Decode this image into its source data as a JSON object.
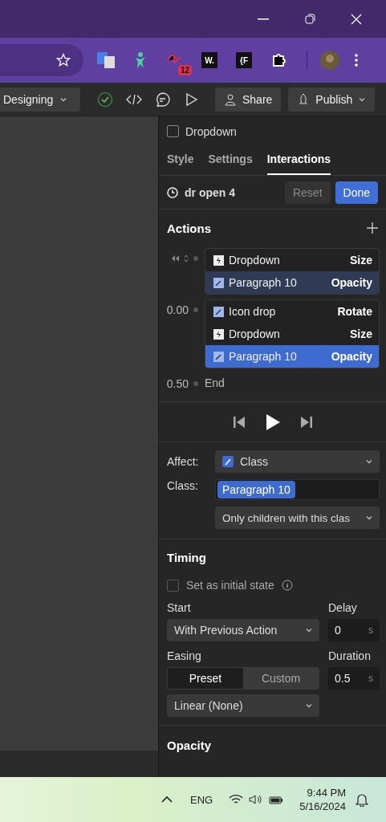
{
  "browser": {
    "extensions": [
      {
        "kind": "translate"
      },
      {
        "kind": "figure"
      },
      {
        "kind": "badge",
        "badge": "12"
      },
      {
        "kind": "logo",
        "label": "W."
      },
      {
        "kind": "logo",
        "label": "{F"
      },
      {
        "kind": "puzzle"
      }
    ]
  },
  "toolbar": {
    "mode": "Designing",
    "share": "Share",
    "publish": "Publish"
  },
  "panel": {
    "element": "Dropdown",
    "tabs": [
      {
        "label": "Style",
        "selected": false
      },
      {
        "label": "Settings",
        "selected": false
      },
      {
        "label": "Interactions",
        "selected": true
      }
    ],
    "trigger": {
      "name": "dr open 4",
      "reset": "Reset",
      "done": "Done"
    },
    "actions": {
      "title": "Actions",
      "groups": [
        {
          "items": [
            {
              "kind": "element",
              "name": "Dropdown",
              "property": "Size",
              "selected": false,
              "related": false
            },
            {
              "kind": "class",
              "name": "Paragraph 10",
              "property": "Opacity",
              "selected": false,
              "related": true
            }
          ]
        },
        {
          "time": "0.00",
          "items": [
            {
              "kind": "class",
              "name": "Icon drop",
              "property": "Rotate",
              "selected": false,
              "related": false
            },
            {
              "kind": "element",
              "name": "Dropdown",
              "property": "Size",
              "selected": false,
              "related": false
            },
            {
              "kind": "class",
              "name": "Paragraph 10",
              "property": "Opacity",
              "selected": true,
              "related": false
            }
          ]
        }
      ],
      "end_time": "0.50",
      "end_label": "End"
    },
    "affect": {
      "label": "Affect:",
      "value": "Class",
      "class_label": "Class:",
      "class_tag": "Paragraph 10",
      "scope": "Only children with this clas"
    },
    "timing": {
      "title": "Timing",
      "initial_state": {
        "label": "Set as initial state",
        "checked": false
      },
      "start_label": "Start",
      "start": "With Previous Action",
      "delay_label": "Delay",
      "delay": "0",
      "delay_unit": "s",
      "easing_label": "Easing",
      "easing_modes": [
        {
          "label": "Preset",
          "selected": true
        },
        {
          "label": "Custom",
          "selected": false
        }
      ],
      "duration_label": "Duration",
      "duration": "0.5",
      "duration_unit": "s",
      "easing": "Linear (None)"
    },
    "opacity": {
      "title": "Opacity"
    }
  },
  "taskbar": {
    "language": "ENG",
    "time": "9:44 PM",
    "date": "5/16/2024"
  }
}
